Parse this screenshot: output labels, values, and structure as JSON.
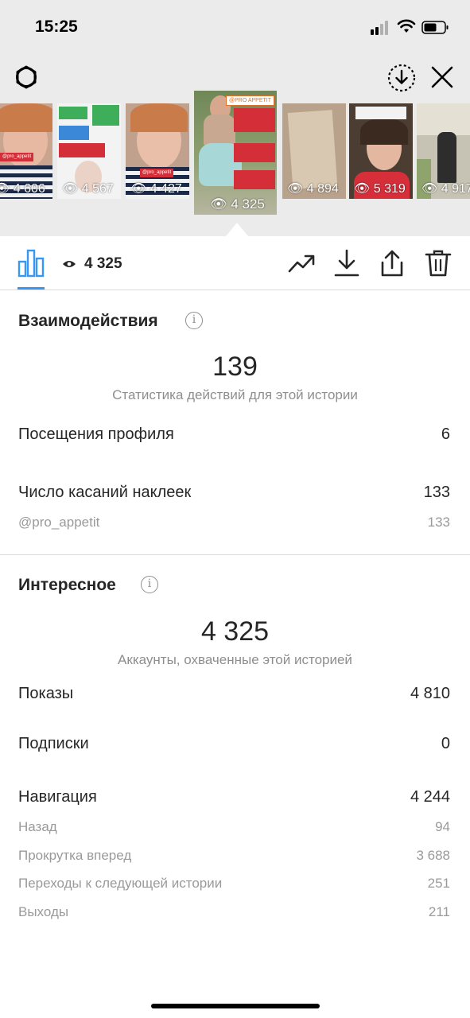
{
  "status_bar": {
    "time": "15:25"
  },
  "stories": [
    {
      "views": "4 606",
      "handle": "@pro_appetit"
    },
    {
      "views": "4 567",
      "handle": ""
    },
    {
      "views": "4 427",
      "handle": "@pro_appetit"
    },
    {
      "views": "4 325",
      "handle": "@PRO APPETIT",
      "active": true
    },
    {
      "views": "4 894",
      "handle": ""
    },
    {
      "views": "5 319",
      "handle": ""
    },
    {
      "views": "4 917",
      "handle": ""
    }
  ],
  "toolbar": {
    "total_views": "4 325"
  },
  "interactions": {
    "title": "Взаимодействия",
    "total": "139",
    "caption": "Статистика действий для этой истории",
    "profile_visits_label": "Посещения профиля",
    "profile_visits_value": "6",
    "sticker_taps_label": "Число касаний наклеек",
    "sticker_taps_value": "133",
    "sticker_handle_label": "@pro_appetit",
    "sticker_handle_value": "133"
  },
  "discovery": {
    "title": "Интересное",
    "total": "4 325",
    "caption": "Аккаунты, охваченные этой историей",
    "impressions_label": "Показы",
    "impressions_value": "4 810",
    "follows_label": "Подписки",
    "follows_value": "0",
    "navigation_label": "Навигация",
    "navigation_value": "4 244",
    "back_label": "Назад",
    "back_value": "94",
    "forward_label": "Прокрутка вперед",
    "forward_value": "3 688",
    "next_story_label": "Переходы к следующей истории",
    "next_story_value": "251",
    "exits_label": "Выходы",
    "exits_value": "211"
  },
  "colors": {
    "accent": "#3897f0",
    "muted": "#8e8e8e"
  },
  "icons": [
    "settings-icon",
    "save-icon",
    "close-icon",
    "bar-chart-icon",
    "eye-icon",
    "trending-icon",
    "download-icon",
    "share-icon",
    "trash-icon",
    "info-icon"
  ]
}
